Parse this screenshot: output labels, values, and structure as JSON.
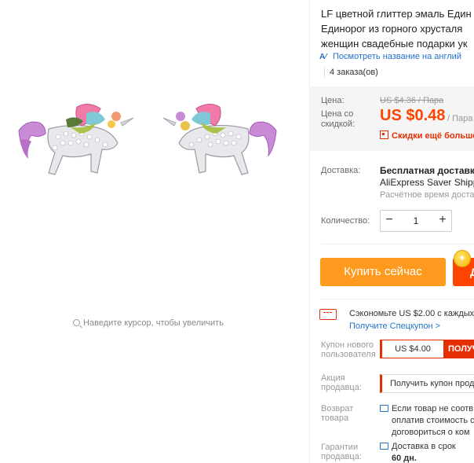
{
  "image": {
    "zoom_hint": "Наведите курсор, чтобы увеличить",
    "icons": [
      "magnifier-icon"
    ]
  },
  "product": {
    "title_lines": [
      "LF цветной глиттер эмаль Един",
      "Единорог из горного хрусталя",
      "женщин свадебные подарки ук"
    ],
    "translate_link": "Посмотреть название на англий",
    "orders": "4 заказа(ов)"
  },
  "price": {
    "label": "Цена:",
    "old": "US $4.36 / Пара",
    "discount_label": "Цена со скидкой:",
    "new": "US $0.48",
    "per_unit": "/ Пара",
    "discount_text": "Скидки ещё больше",
    "accent": "#ff4400"
  },
  "delivery": {
    "label": "Доставка:",
    "value": "Бесплатная доставка",
    "method": "AliExpress Saver Shippi",
    "estimate": "Расчётное время доста"
  },
  "quantity": {
    "label": "Количество:",
    "value": "1",
    "minus": "−",
    "plus": "+"
  },
  "actions": {
    "buy_now": "Купить сейчас",
    "cart_fragment": "Д",
    "buy_color": "#ff9a1e",
    "cart_color": "#ff4400"
  },
  "coupons": {
    "save_text": "Сэкономьте US $2.00 с каждых",
    "get_link": "Получите Спецкупон >",
    "new_user_label": "Купон нового пользователя",
    "new_user_amount": "US $4.00",
    "new_user_get": "ПОЛУЧ",
    "seller_label": "Акция продавца:",
    "seller_get": "Получить купон прод"
  },
  "returns": {
    "label": "Возврат товара",
    "text_lines": [
      "Если товар не соотв",
      "оплатив стоимость с",
      "договориться о ком"
    ]
  },
  "guarantee": {
    "label": "Гарантии продавца:",
    "text_lines": [
      "Доставка в срок",
      "60 дн."
    ]
  }
}
